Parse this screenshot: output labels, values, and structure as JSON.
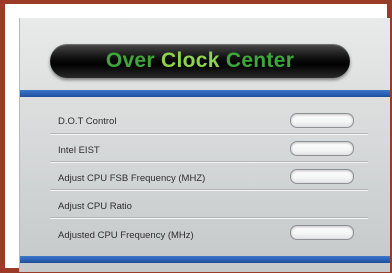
{
  "header": {
    "title_part1": "Over",
    "title_part2": "Clock",
    "title_part3": "Center"
  },
  "rows": [
    {
      "label": "D.O.T Control",
      "has_field": true
    },
    {
      "label": "Intel EIST",
      "has_field": true
    },
    {
      "label": "Adjust CPU FSB Frequency (MHZ)",
      "has_field": true
    },
    {
      "label": "Adjust CPU Ratio",
      "has_field": false
    },
    {
      "label": "Adjusted CPU Frequency (MHz)",
      "has_field": true
    }
  ],
  "colors": {
    "frame_border": "#9a3b27",
    "accent_bar": "#2a5fb4",
    "title_green": "#3fa63b",
    "title_light_green": "#8ed34e"
  }
}
